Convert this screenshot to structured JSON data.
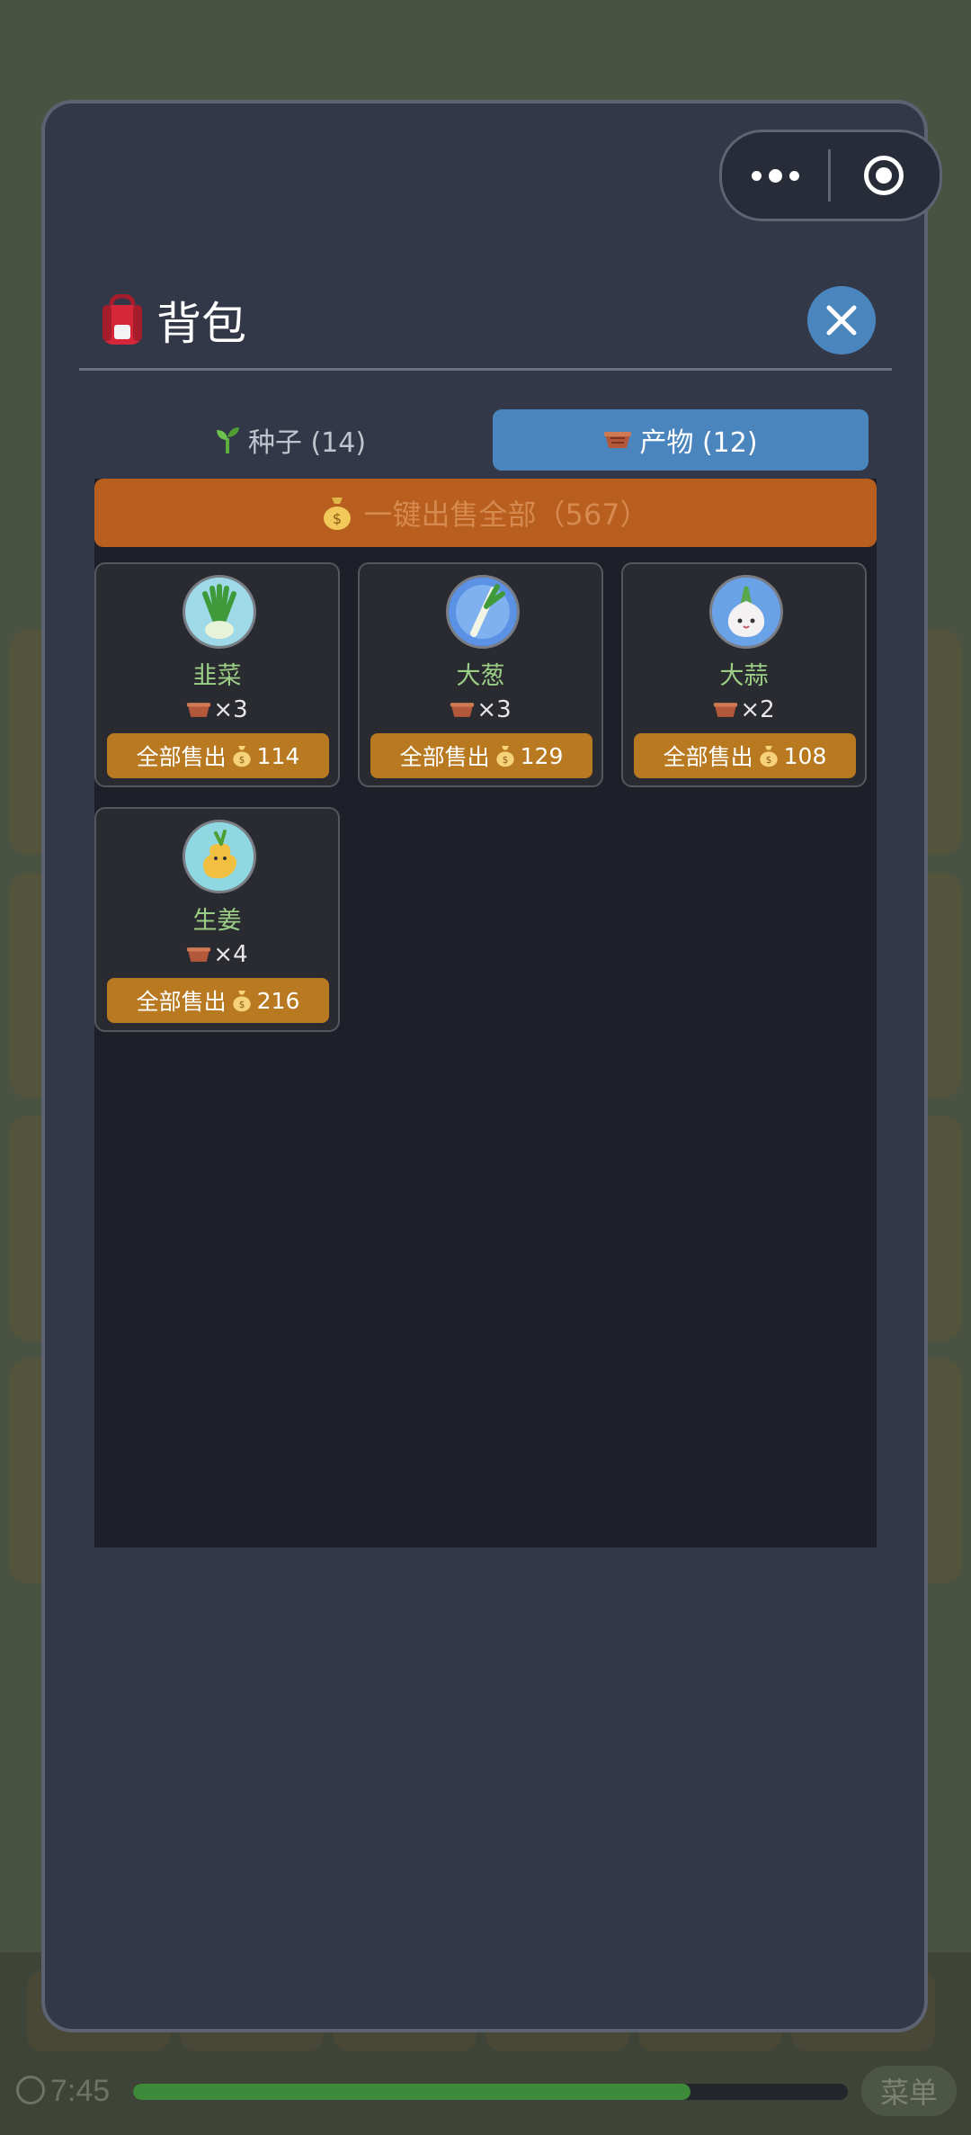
{
  "dialog": {
    "title": "背包",
    "title_icon": "backpack-icon",
    "close_icon": "close-icon"
  },
  "capsule": {
    "more_icon": "more-dots-icon",
    "target_icon": "target-icon"
  },
  "tabs": [
    {
      "label": "种子 (14)",
      "icon": "sprout-icon",
      "active": false
    },
    {
      "label": "产物 (12)",
      "icon": "basket-icon",
      "active": true
    }
  ],
  "sell_all": {
    "label": "一键出售全部（567）",
    "icon": "money-bag-icon"
  },
  "items": [
    {
      "name": "韭菜",
      "count": "×3",
      "sell_label": "全部售出",
      "price": "114",
      "icon": "chives-icon"
    },
    {
      "name": "大葱",
      "count": "×3",
      "sell_label": "全部售出",
      "price": "129",
      "icon": "scallion-icon"
    },
    {
      "name": "大蒜",
      "count": "×2",
      "sell_label": "全部售出",
      "price": "108",
      "icon": "garlic-icon"
    },
    {
      "name": "生姜",
      "count": "×4",
      "sell_label": "全部售出",
      "price": "216",
      "icon": "ginger-icon"
    }
  ],
  "bottom": {
    "time": "7:45",
    "menu_label": "菜单",
    "progress": 0.78
  },
  "colors": {
    "accent_blue": "#4a85bd",
    "sell_orange": "#b85e1e",
    "sell_button": "#b97920",
    "item_name_green": "#9ccf86"
  }
}
